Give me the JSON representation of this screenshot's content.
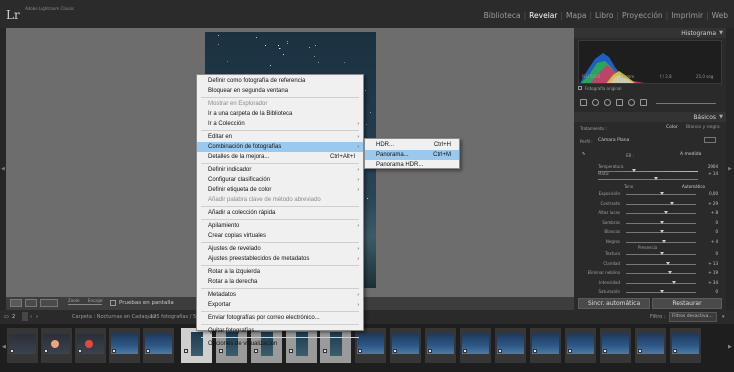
{
  "app": {
    "logo": "Lr",
    "name": "Adobe Lightroom Classic"
  },
  "modules": [
    {
      "label": "Biblioteca",
      "active": false
    },
    {
      "label": "Revelar",
      "active": true
    },
    {
      "label": "Mapa",
      "active": false
    },
    {
      "label": "Libro",
      "active": false
    },
    {
      "label": "Proyección",
      "active": false
    },
    {
      "label": "Imprimir",
      "active": false
    },
    {
      "label": "Web",
      "active": false
    }
  ],
  "toolbar": {
    "zoom_label": "Zoom",
    "zoom_value": "Encajar",
    "soft_proof_label": "Pruebas en pantalla"
  },
  "filmstrip": {
    "page": "2",
    "path": "Carpeta : Nocturnas en Cadaques",
    "count": "125 fotografías / 5 se",
    "filter_label": "Filtro :",
    "filter_value": "Filtros desactiva..."
  },
  "context_menu": {
    "items": [
      {
        "label": "Definir como fotografía de referencia",
        "disabled": false,
        "arrow": false,
        "shortcut": ""
      },
      {
        "label": "Bloquear en segunda ventana",
        "disabled": false,
        "arrow": false,
        "shortcut": ""
      },
      {
        "label": "Mostrar en Explorador",
        "disabled": true,
        "arrow": false,
        "shortcut": ""
      },
      {
        "label": "Ir a una carpeta de la Biblioteca",
        "disabled": false,
        "arrow": false,
        "shortcut": ""
      },
      {
        "label": "Ir a Colección",
        "disabled": false,
        "arrow": true,
        "shortcut": ""
      },
      {
        "label": "Editar en",
        "disabled": false,
        "arrow": true,
        "shortcut": ""
      },
      {
        "label": "Combinación de fotografías",
        "disabled": false,
        "arrow": true,
        "shortcut": "",
        "active": true
      },
      {
        "label": "Detalles de la mejora...",
        "disabled": false,
        "arrow": false,
        "shortcut": "Ctrl+Alt+I"
      },
      {
        "label": "Definir indicador",
        "disabled": false,
        "arrow": true,
        "shortcut": ""
      },
      {
        "label": "Configurar clasificación",
        "disabled": false,
        "arrow": true,
        "shortcut": ""
      },
      {
        "label": "Definir etiqueta de color",
        "disabled": false,
        "arrow": true,
        "shortcut": ""
      },
      {
        "label": "Añadir palabra clave de método abreviado",
        "disabled": true,
        "arrow": false,
        "shortcut": ""
      },
      {
        "label": "Añadir a colección rápida",
        "disabled": false,
        "arrow": false,
        "shortcut": ""
      },
      {
        "label": "Apilamiento",
        "disabled": false,
        "arrow": true,
        "shortcut": ""
      },
      {
        "label": "Crear copias virtuales",
        "disabled": false,
        "arrow": false,
        "shortcut": ""
      },
      {
        "label": "Ajustes de revelado",
        "disabled": false,
        "arrow": true,
        "shortcut": ""
      },
      {
        "label": "Ajustes preestablecidos de metadatos",
        "disabled": false,
        "arrow": true,
        "shortcut": ""
      },
      {
        "label": "Rotar a la izquierda",
        "disabled": false,
        "arrow": false,
        "shortcut": ""
      },
      {
        "label": "Rotar a la derecha",
        "disabled": false,
        "arrow": false,
        "shortcut": ""
      },
      {
        "label": "Metadatos",
        "disabled": false,
        "arrow": true,
        "shortcut": ""
      },
      {
        "label": "Exportar",
        "disabled": false,
        "arrow": true,
        "shortcut": ""
      },
      {
        "label": "Enviar fotografías por correo electrónico...",
        "disabled": false,
        "arrow": false,
        "shortcut": ""
      },
      {
        "label": "Quitar fotografías...",
        "disabled": false,
        "arrow": false,
        "shortcut": ""
      },
      {
        "label": "Opciones de visualización",
        "disabled": false,
        "arrow": true,
        "shortcut": ""
      }
    ]
  },
  "submenu": {
    "items": [
      {
        "label": "HDR...",
        "shortcut": "Ctrl+H",
        "active": false
      },
      {
        "label": "Panorama...",
        "shortcut": "Ctrl+M",
        "active": true
      },
      {
        "label": "Panorama HDR...",
        "shortcut": "",
        "active": false
      }
    ]
  },
  "right_panel": {
    "histogram_title": "Histograma",
    "histo_info": [
      "ISO 6400",
      "11 mm",
      "f / 2,8",
      "25,0 seg"
    ],
    "original_photo_label": "Fotografía original",
    "basic_title": "Básicos",
    "treatment_label": "Tratamiento :",
    "treatment_color": "Color",
    "treatment_bw": "Blanco y negro",
    "profile_label": "Perfil :",
    "profile_value": "Cámara Plana",
    "wb_label": "EB :",
    "wb_value": "A medida",
    "temp_label": "Temperatura",
    "temp_value": "2904",
    "tint_label": "Matiz",
    "tint_value": "+ 14",
    "tone_label": "Tono",
    "auto_label": "Automático",
    "tone_rows": [
      {
        "label": "Exposición",
        "value": "0,00"
      },
      {
        "label": "Contraste",
        "value": "+ 29"
      },
      {
        "label": "Altas luces",
        "value": "+ 8"
      },
      {
        "label": "Sombras",
        "value": "0"
      },
      {
        "label": "Blancos",
        "value": "0"
      },
      {
        "label": "Negros",
        "value": "+ 4"
      }
    ],
    "presence_label": "Presencia",
    "presence_rows": [
      {
        "label": "Textura",
        "value": "0"
      },
      {
        "label": "Claridad",
        "value": "+ 13"
      },
      {
        "label": "Eliminar neblina",
        "value": "+ 19"
      },
      {
        "label": "Intensidad",
        "value": "+ 34"
      },
      {
        "label": "Saturación",
        "value": "0"
      }
    ],
    "prev_button": "Sincr. automática",
    "reset_button": "Restaurar"
  }
}
